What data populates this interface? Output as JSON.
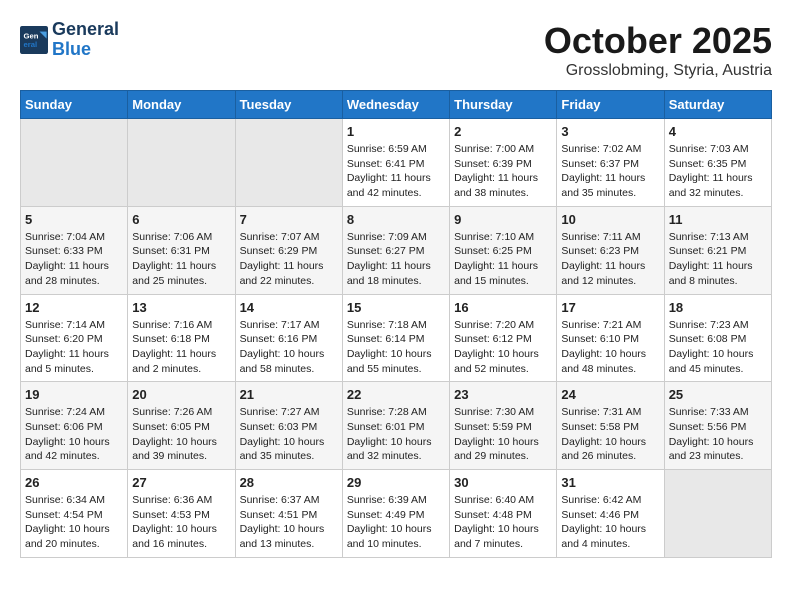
{
  "header": {
    "logo_line1": "General",
    "logo_line2": "Blue",
    "month": "October 2025",
    "location": "Grosslobming, Styria, Austria"
  },
  "weekdays": [
    "Sunday",
    "Monday",
    "Tuesday",
    "Wednesday",
    "Thursday",
    "Friday",
    "Saturday"
  ],
  "weeks": [
    [
      {
        "num": "",
        "info": ""
      },
      {
        "num": "",
        "info": ""
      },
      {
        "num": "",
        "info": ""
      },
      {
        "num": "1",
        "info": "Sunrise: 6:59 AM\nSunset: 6:41 PM\nDaylight: 11 hours\nand 42 minutes."
      },
      {
        "num": "2",
        "info": "Sunrise: 7:00 AM\nSunset: 6:39 PM\nDaylight: 11 hours\nand 38 minutes."
      },
      {
        "num": "3",
        "info": "Sunrise: 7:02 AM\nSunset: 6:37 PM\nDaylight: 11 hours\nand 35 minutes."
      },
      {
        "num": "4",
        "info": "Sunrise: 7:03 AM\nSunset: 6:35 PM\nDaylight: 11 hours\nand 32 minutes."
      }
    ],
    [
      {
        "num": "5",
        "info": "Sunrise: 7:04 AM\nSunset: 6:33 PM\nDaylight: 11 hours\nand 28 minutes."
      },
      {
        "num": "6",
        "info": "Sunrise: 7:06 AM\nSunset: 6:31 PM\nDaylight: 11 hours\nand 25 minutes."
      },
      {
        "num": "7",
        "info": "Sunrise: 7:07 AM\nSunset: 6:29 PM\nDaylight: 11 hours\nand 22 minutes."
      },
      {
        "num": "8",
        "info": "Sunrise: 7:09 AM\nSunset: 6:27 PM\nDaylight: 11 hours\nand 18 minutes."
      },
      {
        "num": "9",
        "info": "Sunrise: 7:10 AM\nSunset: 6:25 PM\nDaylight: 11 hours\nand 15 minutes."
      },
      {
        "num": "10",
        "info": "Sunrise: 7:11 AM\nSunset: 6:23 PM\nDaylight: 11 hours\nand 12 minutes."
      },
      {
        "num": "11",
        "info": "Sunrise: 7:13 AM\nSunset: 6:21 PM\nDaylight: 11 hours\nand 8 minutes."
      }
    ],
    [
      {
        "num": "12",
        "info": "Sunrise: 7:14 AM\nSunset: 6:20 PM\nDaylight: 11 hours\nand 5 minutes."
      },
      {
        "num": "13",
        "info": "Sunrise: 7:16 AM\nSunset: 6:18 PM\nDaylight: 11 hours\nand 2 minutes."
      },
      {
        "num": "14",
        "info": "Sunrise: 7:17 AM\nSunset: 6:16 PM\nDaylight: 10 hours\nand 58 minutes."
      },
      {
        "num": "15",
        "info": "Sunrise: 7:18 AM\nSunset: 6:14 PM\nDaylight: 10 hours\nand 55 minutes."
      },
      {
        "num": "16",
        "info": "Sunrise: 7:20 AM\nSunset: 6:12 PM\nDaylight: 10 hours\nand 52 minutes."
      },
      {
        "num": "17",
        "info": "Sunrise: 7:21 AM\nSunset: 6:10 PM\nDaylight: 10 hours\nand 48 minutes."
      },
      {
        "num": "18",
        "info": "Sunrise: 7:23 AM\nSunset: 6:08 PM\nDaylight: 10 hours\nand 45 minutes."
      }
    ],
    [
      {
        "num": "19",
        "info": "Sunrise: 7:24 AM\nSunset: 6:06 PM\nDaylight: 10 hours\nand 42 minutes."
      },
      {
        "num": "20",
        "info": "Sunrise: 7:26 AM\nSunset: 6:05 PM\nDaylight: 10 hours\nand 39 minutes."
      },
      {
        "num": "21",
        "info": "Sunrise: 7:27 AM\nSunset: 6:03 PM\nDaylight: 10 hours\nand 35 minutes."
      },
      {
        "num": "22",
        "info": "Sunrise: 7:28 AM\nSunset: 6:01 PM\nDaylight: 10 hours\nand 32 minutes."
      },
      {
        "num": "23",
        "info": "Sunrise: 7:30 AM\nSunset: 5:59 PM\nDaylight: 10 hours\nand 29 minutes."
      },
      {
        "num": "24",
        "info": "Sunrise: 7:31 AM\nSunset: 5:58 PM\nDaylight: 10 hours\nand 26 minutes."
      },
      {
        "num": "25",
        "info": "Sunrise: 7:33 AM\nSunset: 5:56 PM\nDaylight: 10 hours\nand 23 minutes."
      }
    ],
    [
      {
        "num": "26",
        "info": "Sunrise: 6:34 AM\nSunset: 4:54 PM\nDaylight: 10 hours\nand 20 minutes."
      },
      {
        "num": "27",
        "info": "Sunrise: 6:36 AM\nSunset: 4:53 PM\nDaylight: 10 hours\nand 16 minutes."
      },
      {
        "num": "28",
        "info": "Sunrise: 6:37 AM\nSunset: 4:51 PM\nDaylight: 10 hours\nand 13 minutes."
      },
      {
        "num": "29",
        "info": "Sunrise: 6:39 AM\nSunset: 4:49 PM\nDaylight: 10 hours\nand 10 minutes."
      },
      {
        "num": "30",
        "info": "Sunrise: 6:40 AM\nSunset: 4:48 PM\nDaylight: 10 hours\nand 7 minutes."
      },
      {
        "num": "31",
        "info": "Sunrise: 6:42 AM\nSunset: 4:46 PM\nDaylight: 10 hours\nand 4 minutes."
      },
      {
        "num": "",
        "info": ""
      }
    ]
  ]
}
